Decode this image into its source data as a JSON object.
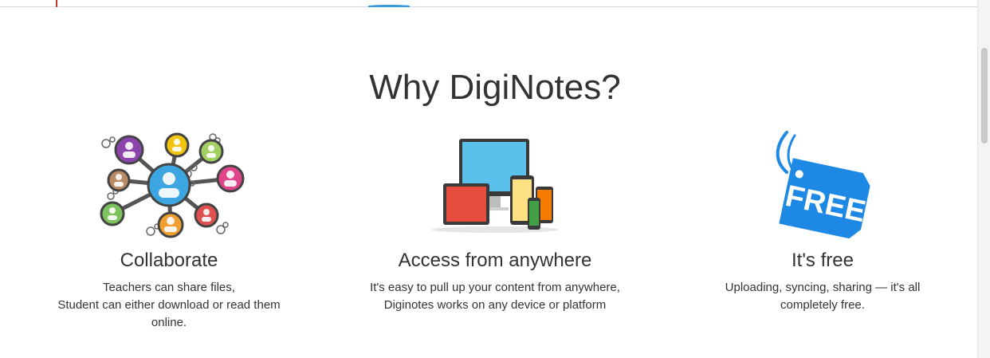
{
  "section": {
    "title": "Why DigiNotes?"
  },
  "features": [
    {
      "icon": "collaboration-network-icon",
      "heading": "Collaborate",
      "lines": [
        "Teachers can share files,",
        "Student can either download or read them",
        "online."
      ]
    },
    {
      "icon": "devices-icon",
      "heading": "Access from anywhere",
      "lines": [
        "It's easy to pull up your content from anywhere,",
        "Diginotes works on any device or platform"
      ]
    },
    {
      "icon": "free-tag-icon",
      "heading": "It's free",
      "lines": [
        "Uploading, syncing, sharing — it's all",
        "completely free."
      ],
      "badge_text": "FREE"
    }
  ],
  "colors": {
    "text": "#333333",
    "tag_blue": "#1e88e5",
    "accent_blue": "#3498db"
  }
}
